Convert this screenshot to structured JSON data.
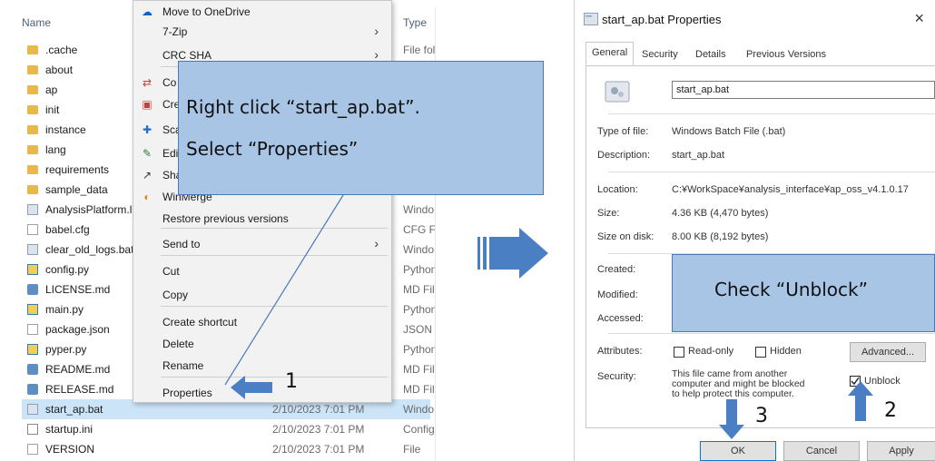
{
  "explorer": {
    "headers": {
      "name": "Name",
      "type": "Type"
    },
    "files": [
      {
        "name": ".cache",
        "date": "",
        "type": "File fol",
        "icon": "folder-icon"
      },
      {
        "name": "about",
        "date": "",
        "type": "",
        "icon": "folder-icon"
      },
      {
        "name": "ap",
        "date": "",
        "type": "",
        "icon": "folder-icon"
      },
      {
        "name": "init",
        "date": "",
        "type": "",
        "icon": "folder-icon"
      },
      {
        "name": "instance",
        "date": "",
        "type": "",
        "icon": "folder-icon"
      },
      {
        "name": "lang",
        "date": "",
        "type": "",
        "icon": "folder-icon"
      },
      {
        "name": "requirements",
        "date": "",
        "type": "",
        "icon": "folder-icon"
      },
      {
        "name": "sample_data",
        "date": "",
        "type": "",
        "icon": "folder-icon"
      },
      {
        "name": "AnalysisPlatform.l",
        "date": "",
        "type": "Windo",
        "icon": "bat-file-icon"
      },
      {
        "name": "babel.cfg",
        "date": "",
        "type": "CFG Fi",
        "icon": "doc-file-icon"
      },
      {
        "name": "clear_old_logs.bat",
        "date": "",
        "type": "Windo",
        "icon": "bat-file-icon"
      },
      {
        "name": "config.py",
        "date": "",
        "type": "Python",
        "icon": "python-file-icon"
      },
      {
        "name": "LICENSE.md",
        "date": "",
        "type": "MD Fil",
        "icon": "md-file-icon"
      },
      {
        "name": "main.py",
        "date": "",
        "type": "Python",
        "icon": "python-file-icon"
      },
      {
        "name": "package.json",
        "date": "",
        "type": "JSON",
        "icon": "doc-file-icon"
      },
      {
        "name": "pyper.py",
        "date": "",
        "type": "Python",
        "icon": "python-file-icon"
      },
      {
        "name": "README.md",
        "date": "",
        "type": "MD Fil",
        "icon": "md-file-icon"
      },
      {
        "name": "RELEASE.md",
        "date": "",
        "type": "MD Fil",
        "icon": "md-file-icon"
      },
      {
        "name": "start_ap.bat",
        "date": "2/10/2023 7:01 PM",
        "type": "Windo",
        "icon": "bat-file-icon",
        "selected": true
      },
      {
        "name": "startup.ini",
        "date": "2/10/2023 7:01 PM",
        "type": "Config",
        "icon": "ini-file-icon"
      },
      {
        "name": "VERSION",
        "date": "2/10/2023 7:01 PM",
        "type": "File",
        "icon": "doc-file-icon"
      }
    ]
  },
  "context_menu": {
    "items": [
      {
        "label": "Move to OneDrive",
        "icon": "onedrive-icon",
        "submenu": false
      },
      {
        "label": "7-Zip",
        "icon": "",
        "submenu": true
      },
      {
        "label": "CRC SHA",
        "icon": "",
        "submenu": true
      },
      {
        "label": "Co",
        "icon": "convert-icon",
        "submenu": false
      },
      {
        "label": "Cre",
        "icon": "create-icon",
        "submenu": false
      },
      {
        "label": "Sca",
        "icon": "scan-icon",
        "submenu": false
      },
      {
        "label": "Edi",
        "icon": "edit-icon",
        "submenu": false
      },
      {
        "label": "Sha",
        "icon": "share-icon",
        "submenu": false
      },
      {
        "label": "WinMerge",
        "icon": "winmerge-icon",
        "submenu": false
      },
      {
        "label": "Restore previous versions",
        "icon": "",
        "submenu": false
      },
      {
        "label": "Send to",
        "icon": "",
        "submenu": true
      },
      {
        "label": "Cut",
        "icon": "",
        "submenu": false
      },
      {
        "label": "Copy",
        "icon": "",
        "submenu": false
      },
      {
        "label": "Create shortcut",
        "icon": "",
        "submenu": false
      },
      {
        "label": "Delete",
        "icon": "",
        "submenu": false
      },
      {
        "label": "Rename",
        "icon": "",
        "submenu": false
      },
      {
        "label": "Properties",
        "icon": "",
        "submenu": false
      }
    ],
    "submenu_arrow": "›"
  },
  "callouts": {
    "step1_line1": "Right click “start_ap.bat”.",
    "step1_line2": "Select “Properties”",
    "step2": "Check “Unblock”"
  },
  "steps": {
    "one": "1",
    "two": "2",
    "three": "3"
  },
  "dialog": {
    "title": "start_ap.bat Properties",
    "close_glyph": "×",
    "tabs": [
      "General",
      "Security",
      "Details",
      "Previous Versions"
    ],
    "filename": "start_ap.bat",
    "type_label": "Type of file:",
    "type_value": "Windows Batch File (.bat)",
    "desc_label": "Description:",
    "desc_value": "start_ap.bat",
    "location_label": "Location:",
    "location_value": "C:¥WorkSpace¥analysis_interface¥ap_oss_v4.1.0.17",
    "size_label": "Size:",
    "size_value": "4.36 KB (4,470 bytes)",
    "size_disk_label": "Size on disk:",
    "size_disk_value": "8.00 KB (8,192 bytes)",
    "created_label": "Created:",
    "modified_label": "Modified:",
    "accessed_label": "Accessed:",
    "attributes_label": "Attributes:",
    "readonly_label": "Read-only",
    "hidden_label": "Hidden",
    "advanced_label": "Advanced...",
    "security_label": "Security:",
    "security_text": [
      "This file came from another",
      "computer and might be blocked",
      "to help protect this computer."
    ],
    "unblock_label": "Unblock",
    "ok_label": "OK",
    "cancel_label": "Cancel",
    "apply_label": "Apply"
  },
  "colors": {
    "callout_fill": "#a9c5e6",
    "callout_border": "#4a78b8",
    "arrow_blue": "#4a7fc4",
    "selection": "#cce4f7"
  }
}
